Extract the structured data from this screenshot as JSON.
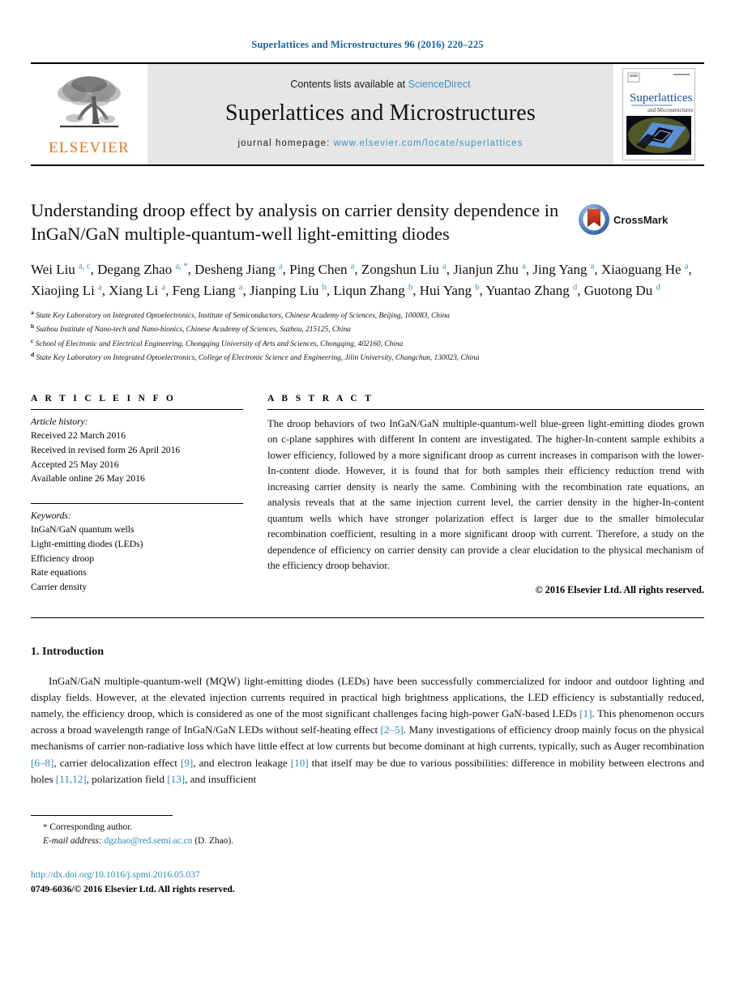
{
  "running_head": "Superlattices and Microstructures 96 (2016) 220–225",
  "masthead": {
    "contents_prefix": "Contents lists available at",
    "sciencedirect": "ScienceDirect",
    "journal_title": "Superlattices and Microstructures",
    "homepage_prefix": "journal homepage:",
    "homepage_url": "www.elsevier.com/locate/superlattices",
    "publisher_logo_text": "ELSEVIER",
    "cover_title_main": "Superlattices",
    "cover_title_sub": "and Microstructures"
  },
  "crossmark": {
    "label": "CrossMark"
  },
  "article": {
    "title": "Understanding droop effect by analysis on carrier density dependence in InGaN/GaN multiple-quantum-well light-emitting diodes",
    "authors": [
      {
        "name": "Wei Liu",
        "sup": "a, c"
      },
      {
        "name": "Degang Zhao",
        "sup": "a, *"
      },
      {
        "name": "Desheng Jiang",
        "sup": "a"
      },
      {
        "name": "Ping Chen",
        "sup": "a"
      },
      {
        "name": "Zongshun Liu",
        "sup": "a"
      },
      {
        "name": "Jianjun Zhu",
        "sup": "a"
      },
      {
        "name": "Jing Yang",
        "sup": "a"
      },
      {
        "name": "Xiaoguang He",
        "sup": "a"
      },
      {
        "name": "Xiaojing Li",
        "sup": "a"
      },
      {
        "name": "Xiang Li",
        "sup": "a"
      },
      {
        "name": "Feng Liang",
        "sup": "a"
      },
      {
        "name": "Jianping Liu",
        "sup": "b"
      },
      {
        "name": "Liqun Zhang",
        "sup": "b"
      },
      {
        "name": "Hui Yang",
        "sup": "b"
      },
      {
        "name": "Yuantao Zhang",
        "sup": "d"
      },
      {
        "name": "Guotong Du",
        "sup": "d"
      }
    ],
    "affiliations": [
      {
        "label": "a",
        "text": "State Key Laboratory on Integrated Optoelectronics, Institute of Semiconductors, Chinese Academy of Sciences, Beijing, 100083, China"
      },
      {
        "label": "b",
        "text": "Suzhou Institute of Nano-tech and Nano-bionics, Chinese Academy of Sciences, Suzhou, 215125, China"
      },
      {
        "label": "c",
        "text": "School of Electronic and Electrical Engineering, Chongqing University of Arts and Sciences, Chongqing, 402160, China"
      },
      {
        "label": "d",
        "text": "State Key Laboratory on Integrated Optoelectronics, College of Electronic Science and Engineering, Jilin University, Changchun, 130023, China"
      }
    ]
  },
  "article_info": {
    "heading": "A R T I C L E   I N F O",
    "history_label": "Article history:",
    "history": [
      "Received 22 March 2016",
      "Received in revised form 26 April 2016",
      "Accepted 25 May 2016",
      "Available online 26 May 2016"
    ],
    "keywords_label": "Keywords:",
    "keywords": [
      "InGaN/GaN quantum wells",
      "Light-emitting diodes (LEDs)",
      "Efficiency droop",
      "Rate equations",
      "Carrier density"
    ]
  },
  "abstract": {
    "heading": "A B S T R A C T",
    "text": "The droop behaviors of two InGaN/GaN multiple-quantum-well blue-green light-emitting diodes grown on c-plane sapphires with different In content are investigated. The higher-In-content sample exhibits a lower efficiency, followed by a more significant droop as current increases in comparison with the lower-In-content diode. However, it is found that for both samples their efficiency reduction trend with increasing carrier density is nearly the same. Combining with the recombination rate equations, an analysis reveals that at the same injection current level, the carrier density in the higher-In-content quantum wells which have stronger polarization effect is larger due to the smaller bimolecular recombination coefficient, resulting in a more significant droop with current. Therefore, a study on the dependence of efficiency on carrier density can provide a clear elucidation to the physical mechanism of the efficiency droop behavior.",
    "copyright": "© 2016 Elsevier Ltd. All rights reserved."
  },
  "introduction": {
    "heading": "1. Introduction",
    "paragraph_parts": [
      {
        "type": "text",
        "value": "InGaN/GaN multiple-quantum-well (MQW) light-emitting diodes (LEDs) have been successfully commercialized for indoor and outdoor lighting and display fields. However, at the elevated injection currents required in practical high brightness applications, the LED efficiency is substantially reduced, namely, the efficiency droop, which is considered as one of the most significant challenges facing high-power GaN-based LEDs "
      },
      {
        "type": "cite",
        "value": "[1]"
      },
      {
        "type": "text",
        "value": ". This phenomenon occurs across a broad wavelength range of InGaN/GaN LEDs without self-heating effect "
      },
      {
        "type": "cite",
        "value": "[2–5]"
      },
      {
        "type": "text",
        "value": ". Many investigations of efficiency droop mainly focus on the physical mechanisms of carrier non-radiative loss which have little effect at low currents but become dominant at high currents, typically, such as Auger recombination "
      },
      {
        "type": "cite",
        "value": "[6–8]"
      },
      {
        "type": "text",
        "value": ", carrier delocalization effect "
      },
      {
        "type": "cite",
        "value": "[9]"
      },
      {
        "type": "text",
        "value": ", and electron leakage "
      },
      {
        "type": "cite",
        "value": "[10]"
      },
      {
        "type": "text",
        "value": " that itself may be due to various possibilities: difference in mobility between electrons and holes "
      },
      {
        "type": "cite",
        "value": "[11,12]"
      },
      {
        "type": "text",
        "value": ", polarization field "
      },
      {
        "type": "cite",
        "value": "[13]"
      },
      {
        "type": "text",
        "value": ", and insufficient"
      }
    ]
  },
  "footnote": {
    "star": "*",
    "corresponding": "Corresponding author.",
    "email_label": "E-mail address:",
    "email": "dgzhao@red.semi.ac.cn",
    "email_suffix": "(D. Zhao)."
  },
  "footer": {
    "doi": "http://dx.doi.org/10.1016/j.spmi.2016.05.037",
    "issn_line": "0749-6036/© 2016 Elsevier Ltd. All rights reserved."
  },
  "colors": {
    "link_blue": "#2f87b7",
    "header_blue": "#1a6496",
    "elsevier_orange": "#E87722",
    "masthead_gray": "#e6e6e6",
    "crossmark_red": "#c0331f",
    "crossmark_blue": "#5b8fc9"
  }
}
